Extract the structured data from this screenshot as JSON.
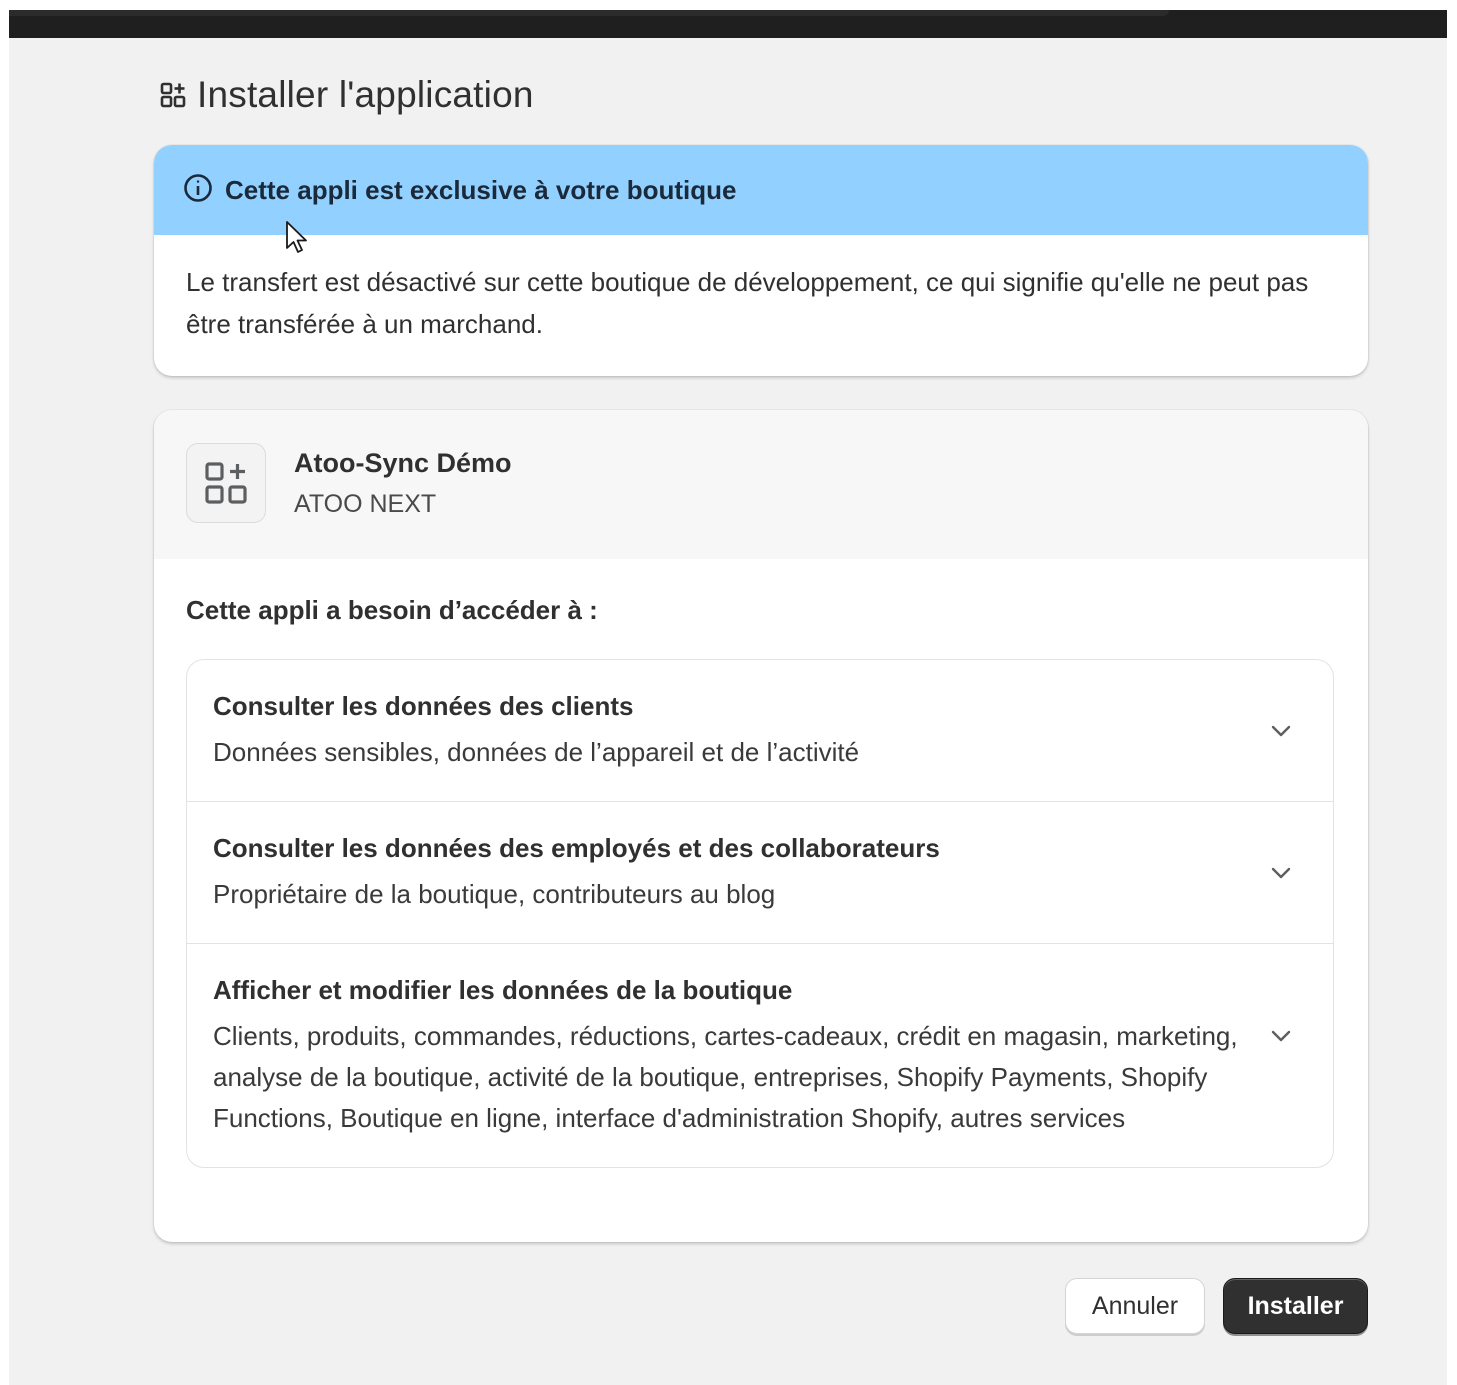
{
  "header": {
    "title": "Installer l'application",
    "title_icon": "apps-icon"
  },
  "banner": {
    "icon": "info-icon",
    "title": "Cette appli est exclusive à votre boutique",
    "body": "Le transfert est désactivé sur cette boutique de développement, ce qui signifie qu'elle ne peut pas être transférée à un marchand.",
    "color": "#91d0ff"
  },
  "app": {
    "icon": "apps-icon",
    "name": "Atoo-Sync Démo",
    "developer": "ATOO NEXT"
  },
  "access": {
    "label": "Cette appli a besoin d’accéder à :",
    "permissions": [
      {
        "title": "Consulter les données des clients",
        "description": "Données sensibles, données de l’appareil et de l’activité"
      },
      {
        "title": "Consulter les données des employés et des collaborateurs",
        "description": "Propriétaire de la boutique, contributeurs au blog"
      },
      {
        "title": "Afficher et modifier les données de la boutique",
        "description": "Clients, produits, commandes, réductions, cartes-cadeaux, crédit en magasin, marketing, analyse de la boutique, activité de la boutique, entreprises, Shopify Payments, Shopify Functions, Boutique en ligne, interface d'administration Shopify, autres services"
      }
    ]
  },
  "actions": {
    "cancel_label": "Annuler",
    "install_label": "Installer",
    "primary_color": "#303030"
  }
}
